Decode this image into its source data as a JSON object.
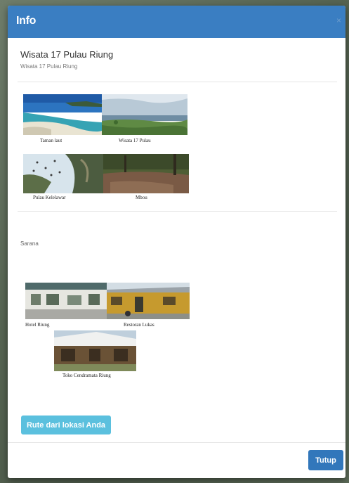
{
  "modal": {
    "title": "Info",
    "close_icon": "close-icon",
    "close_glyph": "×"
  },
  "place": {
    "name": "Wisata 17 Pulau Riung",
    "subtitle": "Wisata 17 Pulau Riung"
  },
  "tourism_gallery": [
    {
      "caption": "Taman laut",
      "image": "beach-lagoon-photo"
    },
    {
      "caption": "Wisata 17 Pulau",
      "image": "sea-islands-photo"
    },
    {
      "caption": "Pulau Kelelawar",
      "image": "bats-tree-photo"
    },
    {
      "caption": "Mbou",
      "image": "forest-clearing-photo"
    }
  ],
  "facilities": {
    "label": "Sarana",
    "items": [
      {
        "caption": "Hotel Riung",
        "image": "hotel-building-photo"
      },
      {
        "caption": "Restoran Lukas",
        "image": "restaurant-building-photo"
      },
      {
        "caption": "Toko Cendramata Riung",
        "image": "souvenir-shop-photo"
      }
    ]
  },
  "actions": {
    "route_label": "Rute dari lokasi Anda",
    "close_label": "Tutup"
  },
  "colors": {
    "header": "#3a7ec2",
    "route_button": "#5bc0de",
    "close_button": "#3277bb"
  }
}
